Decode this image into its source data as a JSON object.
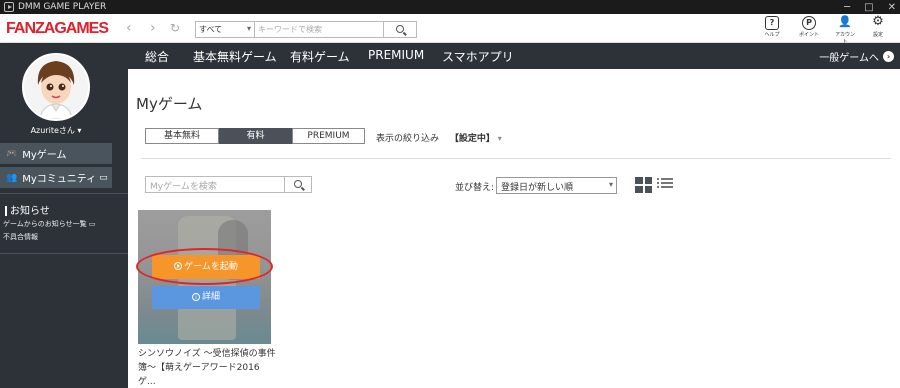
{
  "window": {
    "title": "DMM GAME PLAYER",
    "controls": [
      "─",
      "□",
      "✕"
    ]
  },
  "toolbar": {
    "logo": "FANZAGAMES",
    "back": "‹",
    "forward": "›",
    "reload": "↻",
    "category": "すべて",
    "search_placeholder": "キーワードで検索",
    "icons": [
      {
        "label": "ヘルプ",
        "glyph": "?"
      },
      {
        "label": "ポイント",
        "glyph": "P"
      },
      {
        "label": "アカウント",
        "glyph": "👤"
      },
      {
        "label": "設定",
        "glyph": "⚙"
      }
    ]
  },
  "menu": {
    "items": [
      "総合",
      "基本無料ゲーム",
      "有料ゲーム",
      "PREMIUM",
      "スマホアプリ"
    ],
    "right_link": "一般ゲームへ",
    "right_icon": "›"
  },
  "sidebar": {
    "username": "Azuriteさん",
    "username_caret": "▾",
    "items": [
      {
        "label": "Myゲーム",
        "icon": "🎮"
      },
      {
        "label": "Myコミュニティ",
        "icon": "👥"
      }
    ],
    "notice_title": "お知らせ",
    "notice_links": [
      "ゲームからのお知らせ一覧",
      "不具合情報"
    ]
  },
  "main": {
    "title": "Myゲーム",
    "tabs": [
      {
        "label": "基本無料",
        "active": false
      },
      {
        "label": "有料",
        "active": true
      },
      {
        "label": "PREMIUM",
        "active": false
      }
    ],
    "filter_label": "表示の絞り込み",
    "filter_value": "【設定中】",
    "filter_caret": "▾",
    "search_placeholder": "Myゲームを検索",
    "sort_label": "並び替え:",
    "sort_value": "登録日が新しい順"
  },
  "games": [
    {
      "title_line1": "シンソウノイズ ～受信探偵の事件",
      "title_line2": "簿～【萌えゲーアワード2016 ゲ...",
      "play_label": "ゲームを起動",
      "detail_label": "詳細"
    }
  ],
  "colors": {
    "accent_orange": "#f5952a",
    "accent_blue": "#5a97e0",
    "nav_dark": "#2c3238",
    "logo_red": "#e0202a",
    "highlight_red": "#e2232a"
  }
}
